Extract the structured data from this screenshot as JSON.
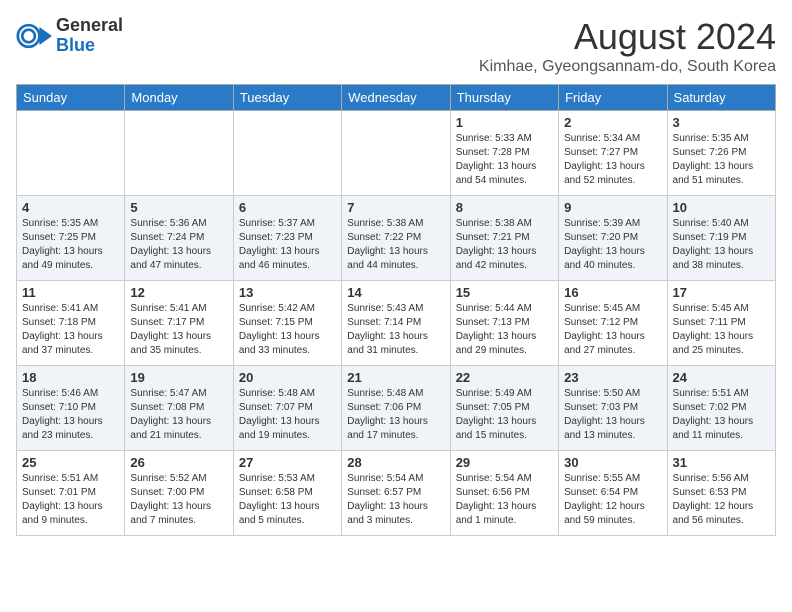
{
  "logo": {
    "general": "General",
    "blue": "Blue"
  },
  "title": "August 2024",
  "location": "Kimhae, Gyeongsannam-do, South Korea",
  "weekdays": [
    "Sunday",
    "Monday",
    "Tuesday",
    "Wednesday",
    "Thursday",
    "Friday",
    "Saturday"
  ],
  "weeks": [
    [
      null,
      null,
      null,
      null,
      {
        "day": 1,
        "sunrise": "5:33 AM",
        "sunset": "7:28 PM",
        "daylight": "13 hours and 54 minutes."
      },
      {
        "day": 2,
        "sunrise": "5:34 AM",
        "sunset": "7:27 PM",
        "daylight": "13 hours and 52 minutes."
      },
      {
        "day": 3,
        "sunrise": "5:35 AM",
        "sunset": "7:26 PM",
        "daylight": "13 hours and 51 minutes."
      }
    ],
    [
      {
        "day": 4,
        "sunrise": "5:35 AM",
        "sunset": "7:25 PM",
        "daylight": "13 hours and 49 minutes."
      },
      {
        "day": 5,
        "sunrise": "5:36 AM",
        "sunset": "7:24 PM",
        "daylight": "13 hours and 47 minutes."
      },
      {
        "day": 6,
        "sunrise": "5:37 AM",
        "sunset": "7:23 PM",
        "daylight": "13 hours and 46 minutes."
      },
      {
        "day": 7,
        "sunrise": "5:38 AM",
        "sunset": "7:22 PM",
        "daylight": "13 hours and 44 minutes."
      },
      {
        "day": 8,
        "sunrise": "5:38 AM",
        "sunset": "7:21 PM",
        "daylight": "13 hours and 42 minutes."
      },
      {
        "day": 9,
        "sunrise": "5:39 AM",
        "sunset": "7:20 PM",
        "daylight": "13 hours and 40 minutes."
      },
      {
        "day": 10,
        "sunrise": "5:40 AM",
        "sunset": "7:19 PM",
        "daylight": "13 hours and 38 minutes."
      }
    ],
    [
      {
        "day": 11,
        "sunrise": "5:41 AM",
        "sunset": "7:18 PM",
        "daylight": "13 hours and 37 minutes."
      },
      {
        "day": 12,
        "sunrise": "5:41 AM",
        "sunset": "7:17 PM",
        "daylight": "13 hours and 35 minutes."
      },
      {
        "day": 13,
        "sunrise": "5:42 AM",
        "sunset": "7:15 PM",
        "daylight": "13 hours and 33 minutes."
      },
      {
        "day": 14,
        "sunrise": "5:43 AM",
        "sunset": "7:14 PM",
        "daylight": "13 hours and 31 minutes."
      },
      {
        "day": 15,
        "sunrise": "5:44 AM",
        "sunset": "7:13 PM",
        "daylight": "13 hours and 29 minutes."
      },
      {
        "day": 16,
        "sunrise": "5:45 AM",
        "sunset": "7:12 PM",
        "daylight": "13 hours and 27 minutes."
      },
      {
        "day": 17,
        "sunrise": "5:45 AM",
        "sunset": "7:11 PM",
        "daylight": "13 hours and 25 minutes."
      }
    ],
    [
      {
        "day": 18,
        "sunrise": "5:46 AM",
        "sunset": "7:10 PM",
        "daylight": "13 hours and 23 minutes."
      },
      {
        "day": 19,
        "sunrise": "5:47 AM",
        "sunset": "7:08 PM",
        "daylight": "13 hours and 21 minutes."
      },
      {
        "day": 20,
        "sunrise": "5:48 AM",
        "sunset": "7:07 PM",
        "daylight": "13 hours and 19 minutes."
      },
      {
        "day": 21,
        "sunrise": "5:48 AM",
        "sunset": "7:06 PM",
        "daylight": "13 hours and 17 minutes."
      },
      {
        "day": 22,
        "sunrise": "5:49 AM",
        "sunset": "7:05 PM",
        "daylight": "13 hours and 15 minutes."
      },
      {
        "day": 23,
        "sunrise": "5:50 AM",
        "sunset": "7:03 PM",
        "daylight": "13 hours and 13 minutes."
      },
      {
        "day": 24,
        "sunrise": "5:51 AM",
        "sunset": "7:02 PM",
        "daylight": "13 hours and 11 minutes."
      }
    ],
    [
      {
        "day": 25,
        "sunrise": "5:51 AM",
        "sunset": "7:01 PM",
        "daylight": "13 hours and 9 minutes."
      },
      {
        "day": 26,
        "sunrise": "5:52 AM",
        "sunset": "7:00 PM",
        "daylight": "13 hours and 7 minutes."
      },
      {
        "day": 27,
        "sunrise": "5:53 AM",
        "sunset": "6:58 PM",
        "daylight": "13 hours and 5 minutes."
      },
      {
        "day": 28,
        "sunrise": "5:54 AM",
        "sunset": "6:57 PM",
        "daylight": "13 hours and 3 minutes."
      },
      {
        "day": 29,
        "sunrise": "5:54 AM",
        "sunset": "6:56 PM",
        "daylight": "13 hours and 1 minute."
      },
      {
        "day": 30,
        "sunrise": "5:55 AM",
        "sunset": "6:54 PM",
        "daylight": "12 hours and 59 minutes."
      },
      {
        "day": 31,
        "sunrise": "5:56 AM",
        "sunset": "6:53 PM",
        "daylight": "12 hours and 56 minutes."
      }
    ]
  ]
}
